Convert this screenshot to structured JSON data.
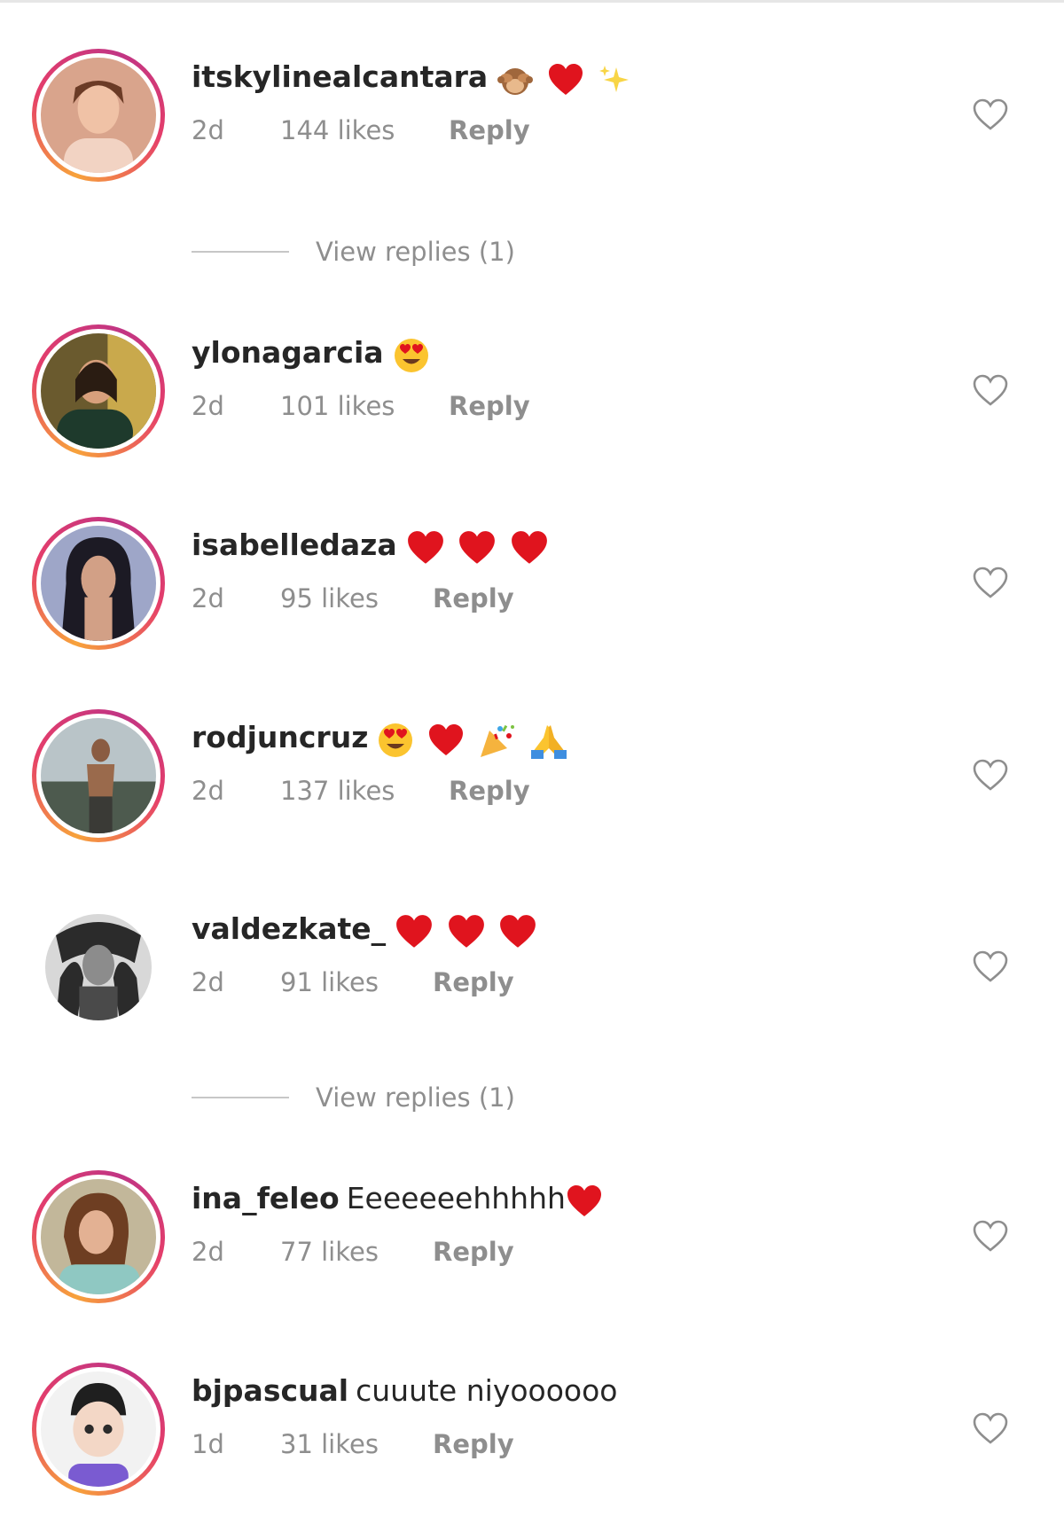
{
  "comments": [
    {
      "username": "itskylinealcantara",
      "text": "",
      "emoji": [
        "see-no-evil-monkey-emoji",
        "red-heart-emoji",
        "sparkles-emoji"
      ],
      "time": "2d",
      "likes": "144 likes",
      "reply_label": "Reply",
      "view_replies": "View replies (1)"
    },
    {
      "username": "ylonagarcia",
      "text": "",
      "emoji": [
        "heart-eyes-emoji"
      ],
      "time": "2d",
      "likes": "101 likes",
      "reply_label": "Reply"
    },
    {
      "username": "isabelledaza",
      "text": "",
      "emoji": [
        "red-heart-emoji",
        "red-heart-emoji",
        "red-heart-emoji"
      ],
      "time": "2d",
      "likes": "95 likes",
      "reply_label": "Reply"
    },
    {
      "username": "rodjuncruz",
      "text": "",
      "emoji": [
        "heart-eyes-emoji",
        "red-heart-emoji",
        "party-popper-emoji",
        "folded-hands-emoji"
      ],
      "time": "2d",
      "likes": "137 likes",
      "reply_label": "Reply"
    },
    {
      "username": "valdezkate_",
      "text": "",
      "emoji": [
        "red-heart-emoji",
        "red-heart-emoji",
        "red-heart-emoji"
      ],
      "time": "2d",
      "likes": "91 likes",
      "reply_label": "Reply",
      "view_replies": "View replies (1)"
    },
    {
      "username": "ina_feleo",
      "text": "Eeeeeeehhhhh",
      "emoji": [
        "red-heart-emoji"
      ],
      "time": "2d",
      "likes": "77 likes",
      "reply_label": "Reply"
    },
    {
      "username": "bjpascual",
      "text": "cuuute niyoooooo",
      "emoji": [],
      "time": "1d",
      "likes": "31 likes",
      "reply_label": "Reply"
    }
  ],
  "icons": {
    "like": "heart-outline-icon",
    "story_ring": "story-ring-gradient"
  },
  "colors": {
    "text_primary": "#262626",
    "text_secondary": "#8e8e8e",
    "heart_red": "#e0141e",
    "ring_orange": "#f7a23b",
    "ring_pink": "#e53e6a"
  }
}
